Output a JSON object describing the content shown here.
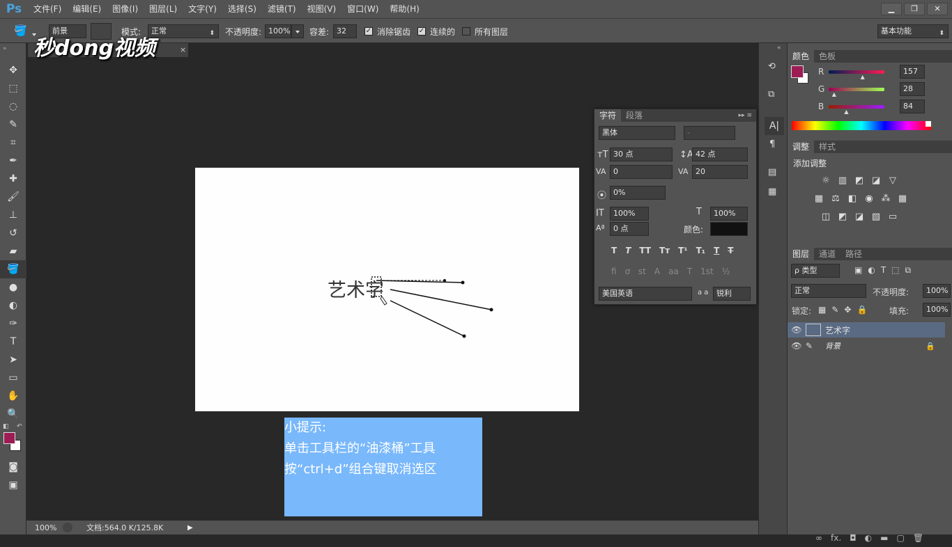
{
  "app": {
    "logo": "Ps"
  },
  "menu": [
    "文件(F)",
    "编辑(E)",
    "图像(I)",
    "图层(L)",
    "文字(Y)",
    "选择(S)",
    "滤镜(T)",
    "视图(V)",
    "窗口(W)",
    "帮助(H)"
  ],
  "window_controls": {
    "minimize": "▁",
    "restore": "❐",
    "close": "✕"
  },
  "watermark": "秒dong视频",
  "options": {
    "fill_source": "前景",
    "mode_label": "模式:",
    "mode_value": "正常",
    "opacity_label": "不透明度:",
    "opacity_value": "100%",
    "tolerance_label": "容差:",
    "tolerance_value": "32",
    "antialias_label": "消除锯齿",
    "contiguous_label": "连续的",
    "all_layers_label": "所有图层",
    "workspace": "基本功能"
  },
  "doc": {
    "tab_close": "×",
    "canvas_text": "艺术字"
  },
  "status": {
    "zoom": "100%",
    "doc_info": "文档:564.0 K/125.8K"
  },
  "color_panel": {
    "tabs": [
      "颜色",
      "色板"
    ],
    "r_label": "R",
    "r_value": "157",
    "g_label": "G",
    "g_value": "28",
    "b_label": "B",
    "b_value": "84",
    "foreground": "#9d1c54",
    "r_level": 0.62,
    "g_level": 0.11,
    "b_level": 0.33
  },
  "adjust_panel": {
    "tabs": [
      "调整",
      "样式"
    ],
    "title": "添加调整"
  },
  "char_panel": {
    "tabs": [
      "字符",
      "段落"
    ],
    "font": "黑体",
    "style": "-",
    "size": "30 点",
    "leading": "42 点",
    "kerning": "0",
    "tracking": "20",
    "tsume": "0%",
    "vscale": "100%",
    "hscale": "100%",
    "baseline": "0 点",
    "color_label": "颜色:",
    "language": "美国英语",
    "aa_label": "a a",
    "aa_value": "锐利"
  },
  "layers_panel": {
    "tabs": [
      "图层",
      "通道",
      "路径"
    ],
    "filter": "ρ 类型",
    "blend": "正常",
    "opacity_label": "不透明度:",
    "opacity": "100%",
    "lock_label": "锁定:",
    "fill_label": "填充:",
    "fill": "100%",
    "layers": [
      {
        "name": "艺术字"
      },
      {
        "name": "背景"
      }
    ],
    "footer": "fx."
  },
  "tip": {
    "line1": "小提示:",
    "line2": "单击工具栏的“油漆桶”工具",
    "line3": "按“ctrl+d”组合键取消选区"
  }
}
